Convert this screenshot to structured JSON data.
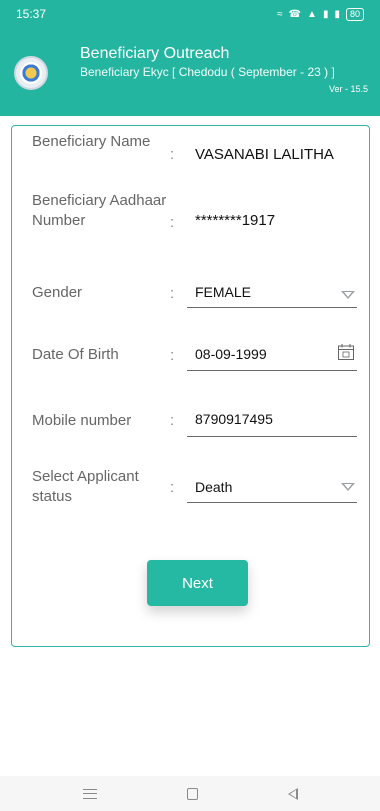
{
  "status_bar": {
    "time": "15:37",
    "icons": [
      "wifi-icon",
      "call-icon",
      "volte-icon",
      "signal-icon",
      "signal-icon"
    ],
    "battery": "80"
  },
  "header": {
    "title": "Beneficiary Outreach",
    "subtitle": "Beneficiary Ekyc [ Chedodu ( September - 23 ) ]",
    "version": "Ver - 15.5",
    "logo_icon": "state-emblem-icon"
  },
  "form": {
    "name_label": "Beneficiary Name",
    "name_value": "VASANABI LALITHA",
    "aadhaar_label": "Beneficiary Aadhaar Number",
    "aadhaar_value": "********1917",
    "gender_label": "Gender",
    "gender_value": "FEMALE",
    "dob_label": "Date Of Birth",
    "dob_value": "08-09-1999",
    "mobile_label": "Mobile number",
    "mobile_value": "8790917495",
    "status_label": "Select Applicant status",
    "status_value": "Death",
    "colon": ":",
    "next_label": "Next"
  },
  "colors": {
    "accent": "#24b5a0",
    "border": "#2fb6a4"
  }
}
